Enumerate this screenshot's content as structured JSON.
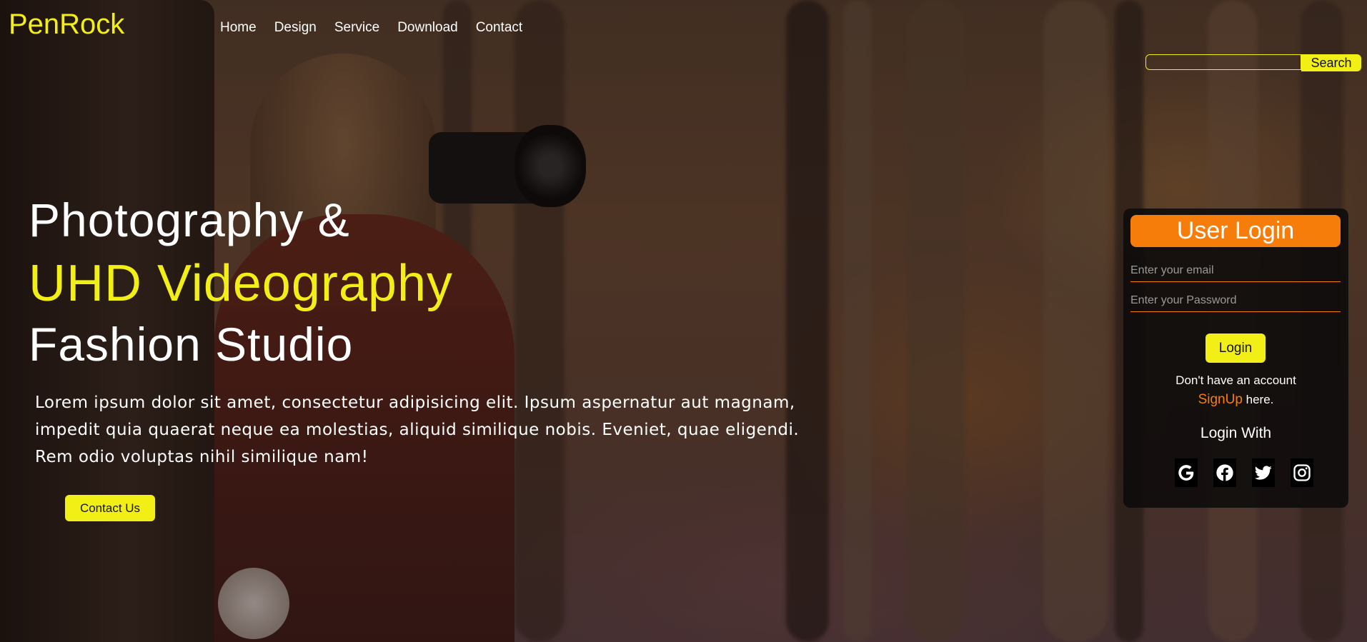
{
  "brand": {
    "logo": "PenRock",
    "accent_color": "#f2ef16",
    "login_accent_color": "#f77d0b"
  },
  "nav": {
    "items": [
      "Home",
      "Design",
      "Service",
      "Download",
      "Contact"
    ]
  },
  "search": {
    "placeholder": "",
    "button_label": "Search"
  },
  "hero": {
    "line1": "Photography &",
    "line2": "UHD Videography",
    "line3": "Fashion Studio",
    "paragraph": "Lorem ipsum dolor sit amet, consectetur adipisicing elit. Ipsum aspernatur aut magnam, impedit quia quaerat neque ea molestias, aliquid similique nobis. Eveniet, quae eligendi. Rem odio voluptas nihil similique nam!",
    "contact_button": "Contact Us"
  },
  "login": {
    "title": "User Login",
    "email_placeholder": "Enter your email",
    "password_placeholder": "Enter your Password",
    "login_button": "Login",
    "no_account_text": "Don't have an account",
    "signup_link": "SignUp",
    "signup_suffix": " here.",
    "login_with": "Login With",
    "social_icons": [
      "google-icon",
      "facebook-icon",
      "twitter-icon",
      "instagram-icon"
    ]
  }
}
